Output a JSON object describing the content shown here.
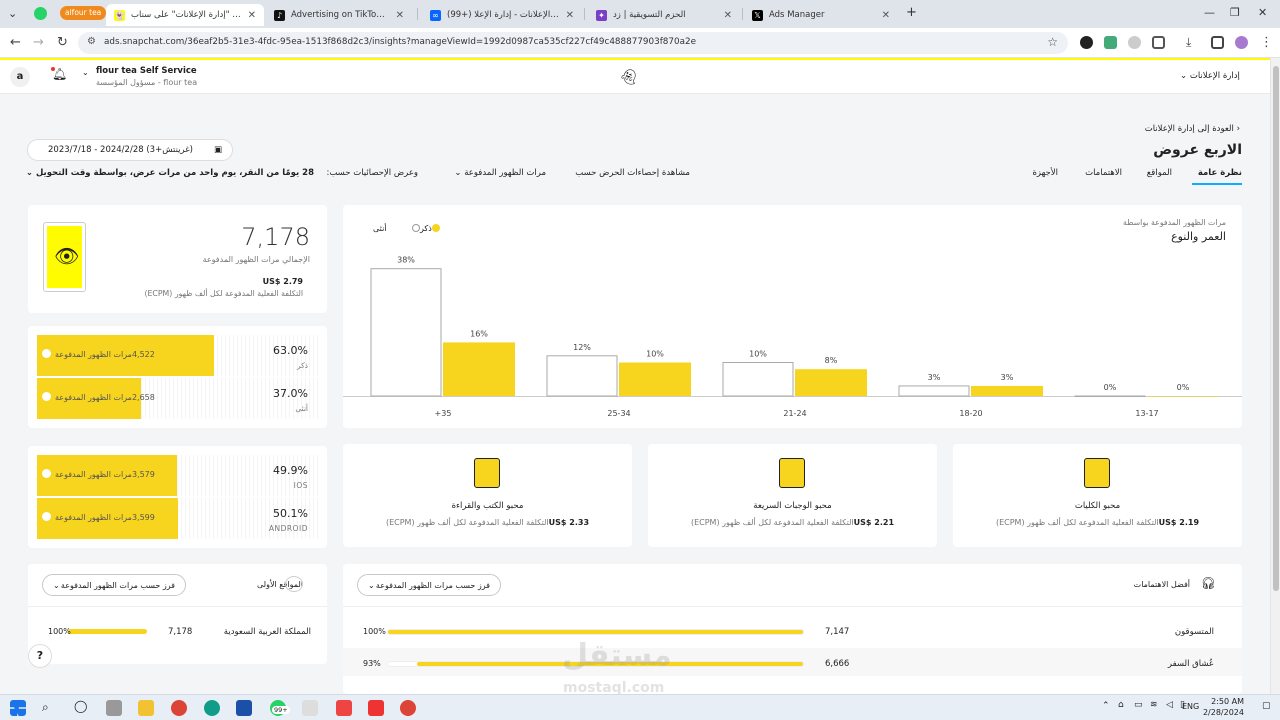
{
  "browser": {
    "tabs": [
      {
        "title": "alfour tea",
        "icon": "whatsapp-icon"
      },
      {
        "title": "منصة \"إدارة الإعلانات\" على سناب",
        "icon": "snapchat-icon"
      },
      {
        "title": "Advertising on TikTok | TikTok A",
        "icon": "tiktok-icon"
      },
      {
        "title": "(99+) مدير الإعلانات - إدارة الإعلا",
        "icon": "meta-icon"
      },
      {
        "title": "الحزم التسويقية | زد",
        "icon": "zid-icon"
      },
      {
        "title": "Ads Manager",
        "icon": "x-icon"
      }
    ],
    "profile_chip": "alfour tea",
    "url": "ads.snapchat.com/36eaf2b5-31e3-4fdc-95ea-1513f868d2c3/insights?manageViewId=1992d0987ca535cf227cf49c488877903f870a2e"
  },
  "header": {
    "avatar_letter": "a",
    "account_name": "flour tea Self Service",
    "account_sub": "مسؤول المؤسسة - flour tea",
    "nav_label": "إدارة الإعلانات"
  },
  "page": {
    "back_link": "العودة إلى إدارة الإعلانات",
    "title": "الاربع عروض",
    "date_range": "2023/7/18 - 2024/2/28 (غرينتش+3)",
    "tabs": [
      "نظرة عامة",
      "المواقع",
      "الاهتمامات",
      "الأجهزة"
    ],
    "stats_by_label": "مشاهدة إحصاءات الحرض حسب",
    "stats_by_value": "مرات الظهور المدفوعة",
    "show_stats_label": "وعرض الإحصائيات حسب:",
    "attribution": "28 يومًا من النقر، يوم واحد من مرات عرض، بواسطة وقت التحويل"
  },
  "summary": {
    "total": "7,178",
    "total_label": "الإجمالي مرات الظهور المدفوعة",
    "ecpm": "2.79 $US",
    "ecpm_label": "التكلفة الفعلية المدفوعة لكل ألف ظهور (ECPM)"
  },
  "gender_split": [
    {
      "pct": "63.0%",
      "label": "ذكر",
      "count": "4,522",
      "metric": "مرات الظهور المدفوعة",
      "fill": 0.63
    },
    {
      "pct": "37.0%",
      "label": "أنثى",
      "count": "2,658",
      "metric": "مرات الظهور المدفوعة",
      "fill": 0.37
    }
  ],
  "os_split": [
    {
      "pct": "49.9%",
      "label": "IOS",
      "count": "3,579",
      "metric": "مرات الظهور المدفوعة",
      "fill": 0.499
    },
    {
      "pct": "50.1%",
      "label": "ANDROID",
      "count": "3,599",
      "metric": "مرات الظهور المدفوعة",
      "fill": 0.501
    }
  ],
  "age_chart": {
    "subtitle": "مرات الظهور المدفوعة بواسطة",
    "title": "العمر والنوع",
    "legend_female": "أنثى",
    "legend_male": "ذكر"
  },
  "chart_data": {
    "type": "bar",
    "categories": [
      "+35",
      "25-34",
      "21-24",
      "18-20",
      "13-17"
    ],
    "series": [
      {
        "name": "ذكر",
        "values": [
          38,
          12,
          10,
          3,
          0
        ],
        "color": "#ffffff"
      },
      {
        "name": "أنثى",
        "values": [
          16,
          10,
          8,
          3,
          0
        ],
        "color": "#f7d51e"
      }
    ],
    "data_labels_male": [
      "38%",
      "12%",
      "10%",
      "3%",
      "0%"
    ],
    "data_labels_female": [
      "16%",
      "10%",
      "8%",
      "3%",
      "0%"
    ],
    "ylim": [
      0,
      40
    ]
  },
  "interests": [
    {
      "name": "محبو الكتب والقراءة",
      "ecpm": "2.33 $US",
      "ecpm_label": "التكلفة الفعلية المدفوعة لكل ألف ظهور (ECPM)",
      "icon": "book-icon"
    },
    {
      "name": "محبو الوجبات السريعة",
      "ecpm": "2.21 $US",
      "ecpm_label": "التكلفة الفعلية المدفوعة لكل ألف ظهور (ECPM)",
      "icon": "fastfood-icon"
    },
    {
      "name": "محبو الكليات",
      "ecpm": "2.19 $US",
      "ecpm_label": "التكلفة الفعلية المدفوعة لكل ألف ظهور (ECPM)",
      "icon": "college-icon"
    }
  ],
  "top_locations": {
    "title": "المواقع الأولى",
    "sort": "فرز حسب مرات الظهور المدفوعة",
    "rows": [
      {
        "name": "المملكة العربية السعودية",
        "value": "7,178",
        "pct": "100%",
        "fill": 1.0
      }
    ]
  },
  "top_interests": {
    "title": "أفضل الاهتمامات",
    "sort": "فرز حسب مرات الظهور المدفوعة",
    "rows": [
      {
        "name": "المتسوقون",
        "value": "7,147",
        "pct": "100%",
        "fill": 1.0
      },
      {
        "name": "عُشاق السفر",
        "value": "6,666",
        "pct": "93%",
        "fill": 0.93
      }
    ]
  },
  "watermark": "مستقل mostaql.com",
  "taskbar": {
    "badge": "99+",
    "lang": "ENG",
    "time": "2:50 AM",
    "date": "2/28/2024"
  },
  "colors": {
    "brand_yellow": "#fffc00",
    "bar_yellow": "#f7d51e"
  }
}
